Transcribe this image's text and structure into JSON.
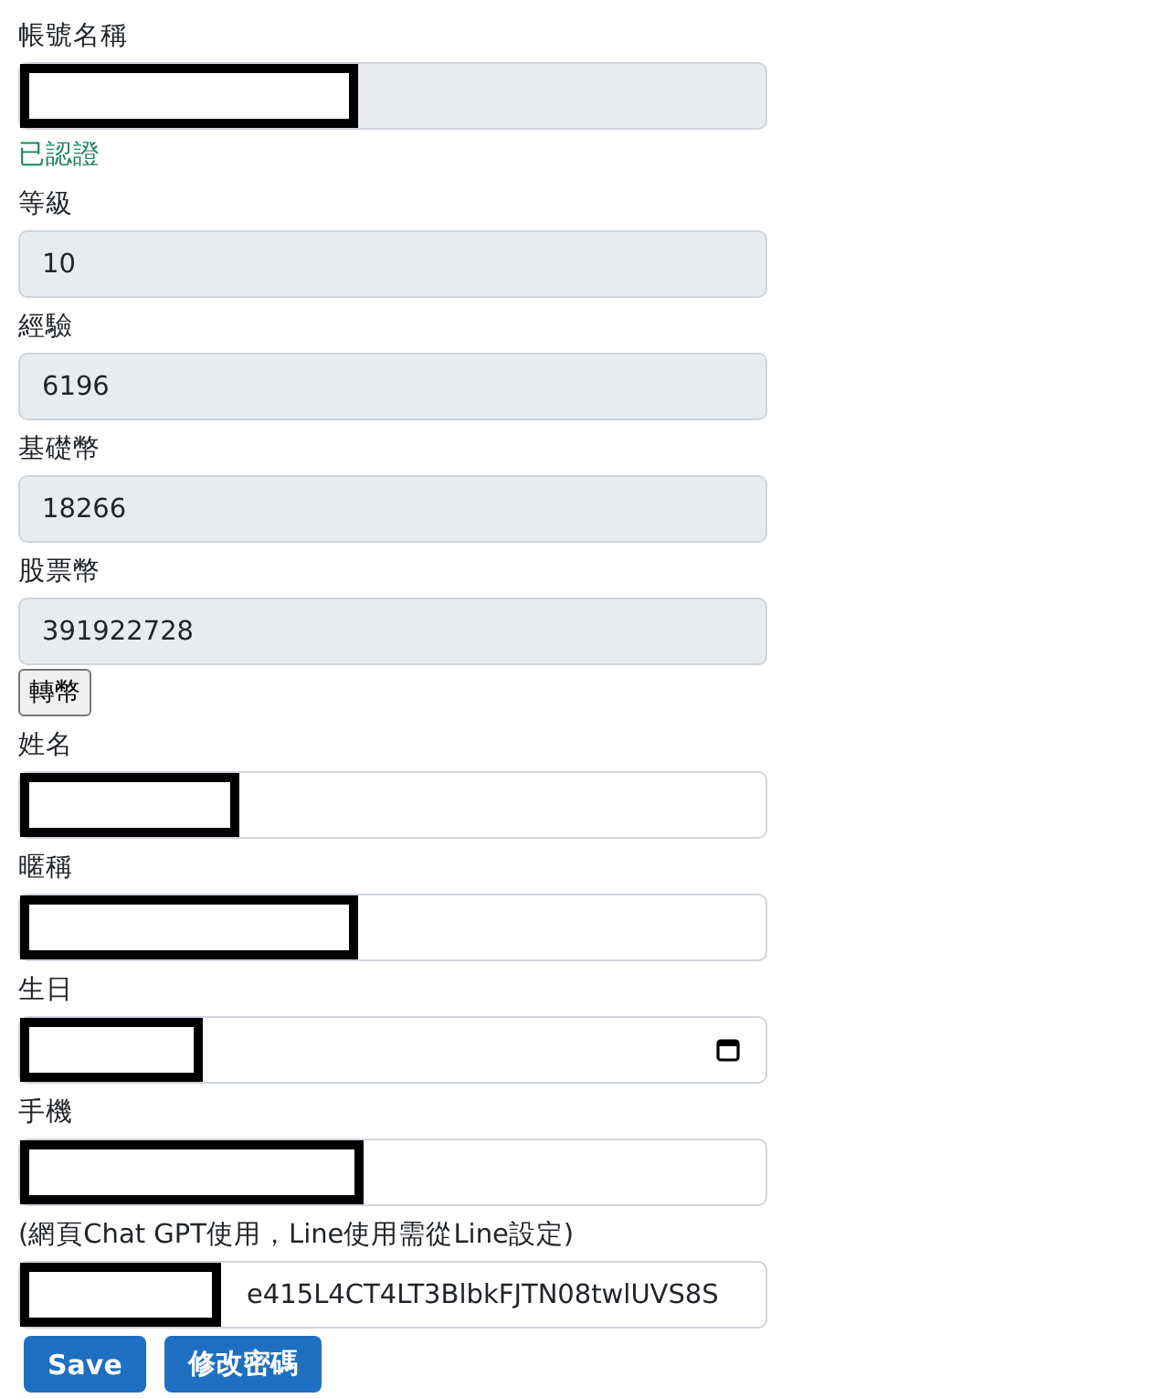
{
  "fields": [
    {
      "kind": "readonly",
      "label": "帳號名稱",
      "redacted": true,
      "status": "已認證"
    },
    {
      "kind": "readonly",
      "label": "等級",
      "value": "10",
      "redacted": false
    },
    {
      "kind": "readonly",
      "label": "經驗",
      "value": "6196",
      "redacted": false
    },
    {
      "kind": "readonly",
      "label": "基礎幣",
      "value": "18266",
      "redacted": false
    },
    {
      "kind": "readonly",
      "label": "股票幣",
      "value": "391922728",
      "redacted": false,
      "action": "轉幣"
    },
    {
      "kind": "text",
      "label": "姓名",
      "redacted": true
    },
    {
      "kind": "text",
      "label": "暱稱",
      "redacted": true
    },
    {
      "kind": "date",
      "label": "生日",
      "redacted": true
    },
    {
      "kind": "text",
      "label": "手機",
      "redacted": true
    },
    {
      "kind": "text",
      "label": "(網頁Chat GPT使用，Line使用需從Line設定)",
      "value": "e415L4CT4LT3BlbkFJTN08twlUVS8S",
      "redacted": true
    }
  ],
  "buttons": [
    "Save",
    "修改密碼"
  ]
}
